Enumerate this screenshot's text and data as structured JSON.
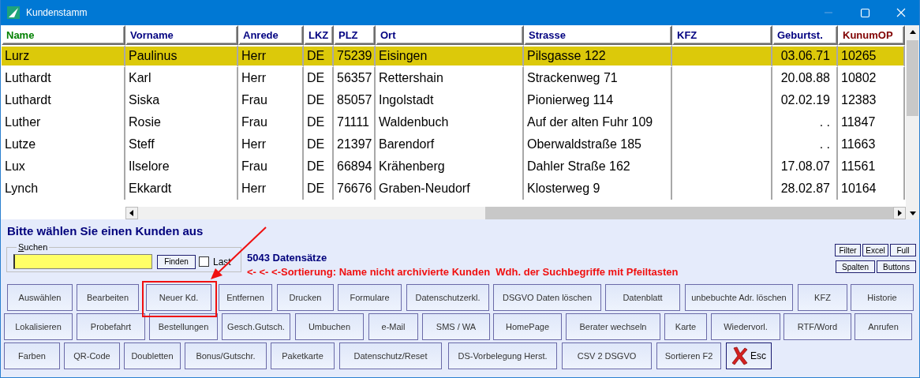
{
  "window": {
    "title": "Kundenstamm"
  },
  "table": {
    "columns": [
      {
        "label": "Name",
        "color": "#008000"
      },
      {
        "label": "Vorname",
        "color": "#000080"
      },
      {
        "label": "Anrede",
        "color": "#000080"
      },
      {
        "label": "LKZ",
        "color": "#000080"
      },
      {
        "label": "PLZ",
        "color": "#000080"
      },
      {
        "label": "Ort",
        "color": "#000080"
      },
      {
        "label": "Strasse",
        "color": "#000080"
      },
      {
        "label": "KFZ",
        "color": "#000080"
      },
      {
        "label": "Geburtst.",
        "color": "#000080"
      },
      {
        "label": "KunumOP",
        "color": "#800000"
      }
    ],
    "rows": [
      {
        "selected": true,
        "cells": [
          "Lurz",
          "Paulinus",
          "Herr",
          "DE",
          "75239",
          "Eisingen",
          "Pilsgasse 122",
          "",
          "03.06.71",
          "10265"
        ]
      },
      {
        "selected": false,
        "cells": [
          "Luthardt",
          "Karl",
          "Herr",
          "DE",
          "56357",
          "Rettershain",
          "Strackenweg 71",
          "",
          "20.08.88",
          "10802"
        ]
      },
      {
        "selected": false,
        "cells": [
          "Luthardt",
          "Siska",
          "Frau",
          "DE",
          "85057",
          "Ingolstadt",
          "Pionierweg 114",
          "",
          "02.02.19",
          "12383"
        ]
      },
      {
        "selected": false,
        "cells": [
          "Luther",
          "Rosie",
          "Frau",
          "DE",
          "71111",
          "Waldenbuch",
          "Auf der alten Fuhr 109",
          "",
          ". .",
          "11847"
        ]
      },
      {
        "selected": false,
        "cells": [
          "Lutze",
          "Steff",
          "Herr",
          "DE",
          "21397",
          "Barendorf",
          "Oberwaldstraße 185",
          "",
          ". .",
          "11663"
        ]
      },
      {
        "selected": false,
        "cells": [
          "Lux",
          "Ilselore",
          "Frau",
          "DE",
          "66894",
          "Krähenberg",
          "Dahler Straße 162",
          "",
          "17.08.07",
          "11561"
        ]
      },
      {
        "selected": false,
        "cells": [
          "Lynch",
          "Ekkardt",
          "Herr",
          "DE",
          "76676",
          "Graben-Neudorf",
          "Klosterweg 9",
          "",
          "28.02.87",
          "10164"
        ]
      }
    ]
  },
  "prompt": "Bitte wählen Sie einen Kunden aus",
  "search": {
    "legend": "Suchen",
    "find_button": "Finden",
    "last_checkbox": {
      "label": "Last",
      "checked": false
    }
  },
  "record_count": "5043 Datensätze",
  "sort_hint": "<- <- <-Sortierung: Name nicht archivierte Kunden  Wdh. der Suchbegriffe mit Pfeiltasten",
  "small_buttons": [
    [
      "Filter",
      "Excel",
      "Full"
    ],
    [
      "Spalten",
      "Buttons"
    ]
  ],
  "button_rows": [
    [
      {
        "label": "Auswählen",
        "kind": "text"
      },
      {
        "label": "Bearbeiten",
        "kind": "text"
      },
      {
        "label": "Neuer Kd.",
        "kind": "text"
      },
      {
        "label": "Entfernen",
        "kind": "text"
      },
      {
        "label": "Drucken",
        "kind": "text"
      },
      {
        "label": "Formulare",
        "kind": "text"
      },
      {
        "label": "Datenschutzerkl.",
        "kind": "text"
      },
      {
        "label": "DSGVO Daten löschen",
        "kind": "text"
      },
      {
        "label": "Datenblatt",
        "kind": "text"
      },
      {
        "label": "unbebuchte Adr. löschen",
        "kind": "text"
      },
      {
        "label": "KFZ",
        "kind": "text"
      },
      {
        "label": "Historie",
        "kind": "text"
      }
    ],
    [
      {
        "label": "Lokalisieren",
        "kind": "text"
      },
      {
        "label": "Probefahrt",
        "kind": "text"
      },
      {
        "label": "Bestellungen",
        "kind": "text"
      },
      {
        "label": "Gesch.Gutsch.",
        "kind": "text"
      },
      {
        "label": "Umbuchen",
        "kind": "text"
      },
      {
        "label": "e-Mail",
        "kind": "text"
      },
      {
        "label": "SMS / WA",
        "kind": "text"
      },
      {
        "label": "HomePage",
        "kind": "text"
      },
      {
        "label": "Berater wechseln",
        "kind": "text"
      },
      {
        "label": "Karte",
        "kind": "text"
      },
      {
        "label": "Wiedervorl.",
        "kind": "text"
      },
      {
        "label": "RTF/Word",
        "kind": "text"
      },
      {
        "label": "Anrufen",
        "kind": "text"
      }
    ],
    [
      {
        "label": "Farben",
        "kind": "text"
      },
      {
        "label": "QR-Code",
        "kind": "text"
      },
      {
        "label": "Doubletten",
        "kind": "text"
      },
      {
        "label": "Bonus/Gutschr.",
        "kind": "text"
      },
      {
        "label": "Paketkarte",
        "kind": "text"
      },
      {
        "label": "Datenschutz/Reset",
        "kind": "text"
      },
      {
        "label": "DS-Vorbelegung Herst.",
        "kind": "text"
      },
      {
        "label": "CSV 2 DSGVO",
        "kind": "text"
      },
      {
        "label": "Sortieren F2",
        "kind": "text"
      },
      {
        "label": "Esc",
        "kind": "close"
      }
    ]
  ]
}
